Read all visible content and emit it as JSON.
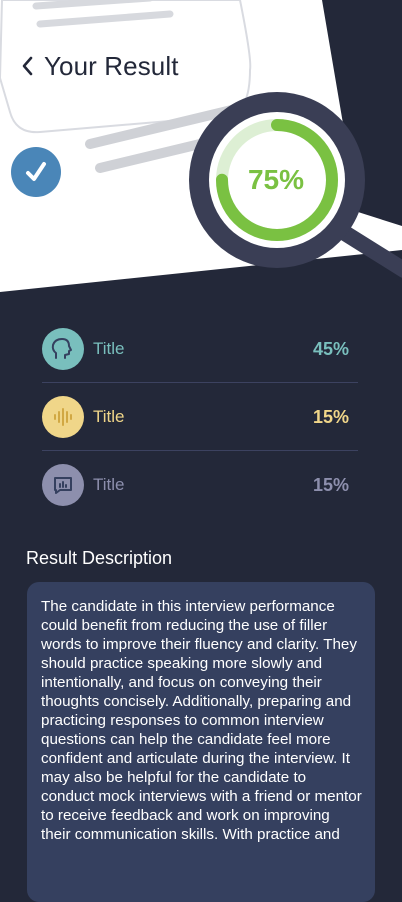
{
  "header": {
    "title": "Your Result"
  },
  "score": {
    "label": "75%",
    "fraction": 0.75
  },
  "metrics": [
    {
      "title": "Title",
      "value": "45%",
      "icon": "speaking-head-icon",
      "color": "#79bfbd"
    },
    {
      "title": "Title",
      "value": "15%",
      "icon": "sound-wave-icon",
      "color": "#f0d689"
    },
    {
      "title": "Title",
      "value": "15%",
      "icon": "chat-chart-icon",
      "color": "#8d8fad"
    }
  ],
  "description": {
    "heading": "Result Description",
    "text": "The candidate in this interview performance could benefit from reducing the use of filler words to improve their fluency and clarity. They should practice speaking more slowly and intentionally, and focus on conveying their thoughts concisely. Additionally, preparing and practicing responses to common interview questions can help the candidate feel more confident and articulate during the interview. It may also be helpful for the candidate to conduct mock interviews with a friend or mentor to receive feedback and work on improving their communication skills. With practice and"
  },
  "colors": {
    "background": "#232839",
    "accent_green": "#7ac142",
    "card": "#35405f",
    "check_badge": "#4a86b8"
  }
}
